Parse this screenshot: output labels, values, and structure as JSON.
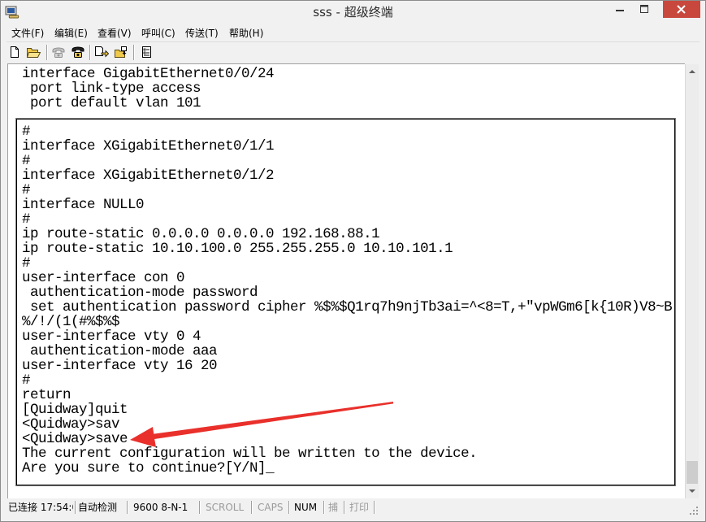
{
  "window": {
    "title": "sss - 超级终端",
    "icon": "hyperterminal-app-icon",
    "controls": {
      "minimize": "minimize-icon",
      "maximize": "maximize-icon",
      "close": "close-icon"
    }
  },
  "menu": {
    "items": [
      {
        "label": "文件(F)"
      },
      {
        "label": "编辑(E)"
      },
      {
        "label": "查看(V)"
      },
      {
        "label": "呼叫(C)"
      },
      {
        "label": "传送(T)"
      },
      {
        "label": "帮助(H)"
      }
    ]
  },
  "toolbar": {
    "buttons": [
      {
        "icon": "new-file-icon",
        "enabled": true
      },
      {
        "icon": "open-folder-icon",
        "enabled": true
      },
      {
        "icon": "call-icon",
        "enabled": false
      },
      {
        "icon": "hang-up-icon",
        "enabled": true
      },
      {
        "icon": "send-file-icon",
        "enabled": true
      },
      {
        "icon": "receive-file-icon",
        "enabled": true
      },
      {
        "icon": "properties-icon",
        "enabled": true
      }
    ]
  },
  "terminal": {
    "scrollback": [
      "interface GigabitEthernet0/0/24",
      " port link-type access",
      " port default vlan 101"
    ],
    "lines": [
      "#",
      "interface XGigabitEthernet0/1/1",
      "#",
      "interface XGigabitEthernet0/1/2",
      "#",
      "interface NULL0",
      "#",
      "ip route-static 0.0.0.0 0.0.0.0 192.168.88.1",
      "ip route-static 10.10.100.0 255.255.255.0 10.10.101.1",
      "#",
      "user-interface con 0",
      " authentication-mode password",
      " set authentication password cipher %$%$Q1rq7h9njTb3ai=^<8=T,+\"vpWGm6[k{10R)V8~B",
      "%/!/(1(#%$%$",
      "user-interface vty 0 4",
      " authentication-mode aaa",
      "user-interface vty 16 20",
      "#",
      "return",
      "[Quidway]quit",
      "<Quidway>sav",
      "<Quidway>save",
      "The current configuration will be written to the device.",
      "Are you sure to continue?[Y/N]"
    ],
    "cursor": "_"
  },
  "status_bar": {
    "connection": "已连接 17:54:0",
    "detect": "自动检测",
    "port_settings": "9600 8-N-1",
    "scroll": "SCROLL",
    "caps": "CAPS",
    "num": "NUM",
    "capture": "捕",
    "print": "打印"
  },
  "colors": {
    "arrow": "#e9302b",
    "close_button": "#c9483e",
    "disabled_text": "#9b9b9b"
  }
}
